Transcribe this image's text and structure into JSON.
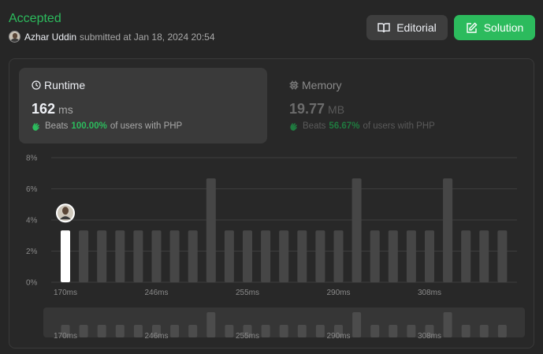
{
  "submission": {
    "status": "Accepted",
    "author": "Azhar Uddin",
    "submitted_text": "submitted at Jan 18, 2024 20:54"
  },
  "buttons": {
    "editorial_label": "Editorial",
    "solution_label": "Solution"
  },
  "runtime": {
    "title": "Runtime",
    "value": "162",
    "unit": "ms",
    "beats_label": "Beats",
    "beats_pct": "100.00%",
    "beats_suffix": "of users with PHP"
  },
  "memory": {
    "title": "Memory",
    "value": "19.77",
    "unit": "MB",
    "beats_label": "Beats",
    "beats_pct": "56.67%",
    "beats_suffix": "of users with PHP"
  },
  "colors": {
    "accent": "#2cbb5d",
    "background": "#262626",
    "bar": "#464646",
    "bar_highlight": "#ffffff"
  },
  "chart_data": {
    "type": "bar",
    "ylim": [
      0,
      8
    ],
    "yticks": [
      "0%",
      "2%",
      "4%",
      "6%",
      "8%"
    ],
    "ytick_values": [
      0,
      2,
      4,
      6,
      8
    ],
    "xtick_labels": [
      "170ms",
      "246ms",
      "255ms",
      "290ms",
      "308ms"
    ],
    "xtick_bar_index": [
      0,
      5,
      10,
      15,
      20
    ],
    "values": [
      3.33,
      3.33,
      3.33,
      3.33,
      3.33,
      3.33,
      3.33,
      3.33,
      6.67,
      3.33,
      3.33,
      3.33,
      3.33,
      3.33,
      3.33,
      3.33,
      6.67,
      3.33,
      3.33,
      3.33,
      3.33,
      6.67,
      3.33,
      3.33,
      3.33
    ],
    "highlight_index": 0,
    "grid": true
  }
}
